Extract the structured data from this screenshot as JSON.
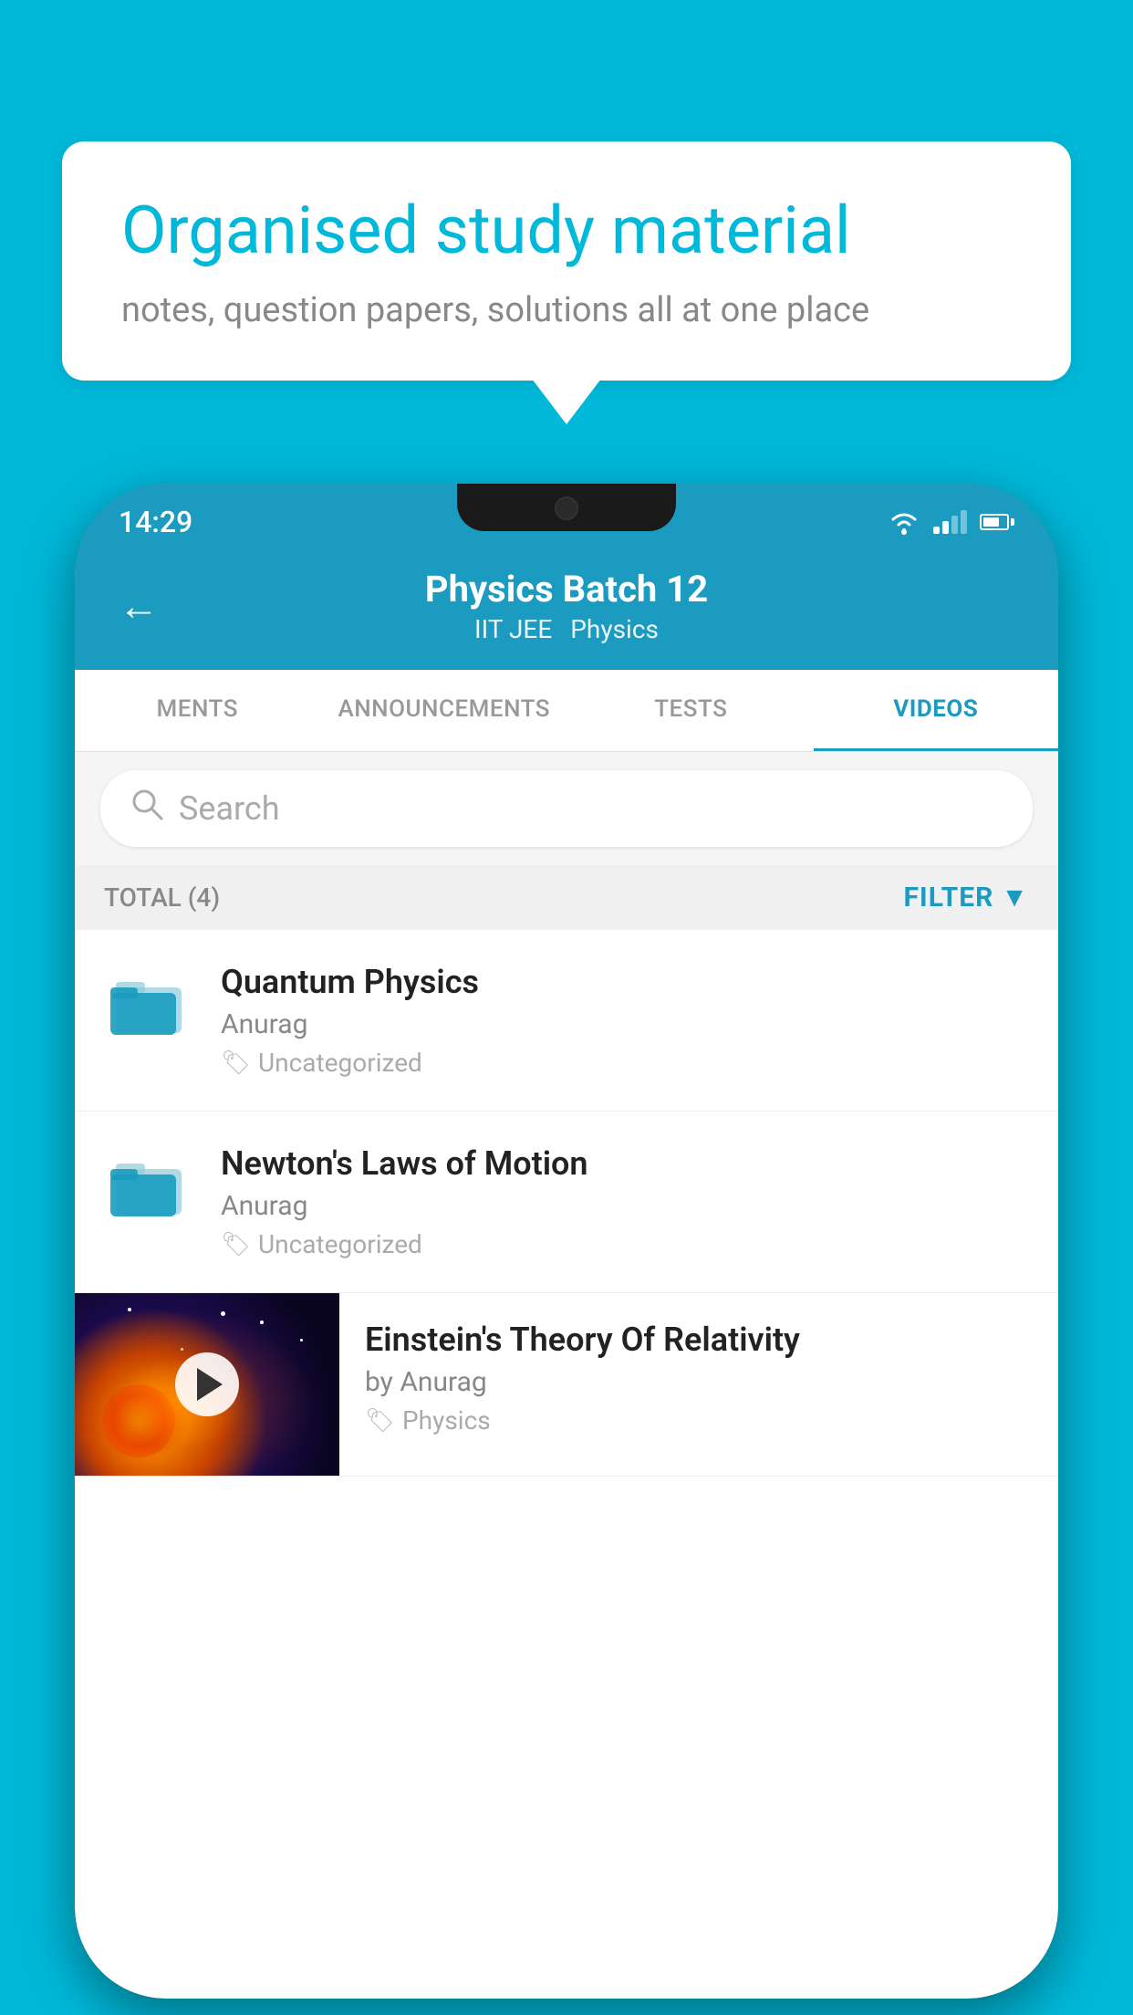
{
  "app": {
    "background_color": "#00b8d9"
  },
  "speech_bubble": {
    "title": "Organised study material",
    "subtitle": "notes, question papers, solutions all at one place"
  },
  "status_bar": {
    "time": "14:29"
  },
  "app_header": {
    "title": "Physics Batch 12",
    "subtitle1": "IIT JEE",
    "subtitle2": "Physics",
    "back_label": "←"
  },
  "tabs": [
    {
      "label": "MENTS",
      "active": false
    },
    {
      "label": "ANNOUNCEMENTS",
      "active": false
    },
    {
      "label": "TESTS",
      "active": false
    },
    {
      "label": "VIDEOS",
      "active": true
    }
  ],
  "search": {
    "placeholder": "Search"
  },
  "filter_bar": {
    "total_label": "TOTAL (4)",
    "filter_label": "FILTER"
  },
  "videos": [
    {
      "title": "Quantum Physics",
      "author": "Anurag",
      "tag": "Uncategorized",
      "type": "folder"
    },
    {
      "title": "Newton's Laws of Motion",
      "author": "Anurag",
      "tag": "Uncategorized",
      "type": "folder"
    },
    {
      "title": "Einstein's Theory Of Relativity",
      "author": "by Anurag",
      "tag": "Physics",
      "type": "video"
    }
  ]
}
